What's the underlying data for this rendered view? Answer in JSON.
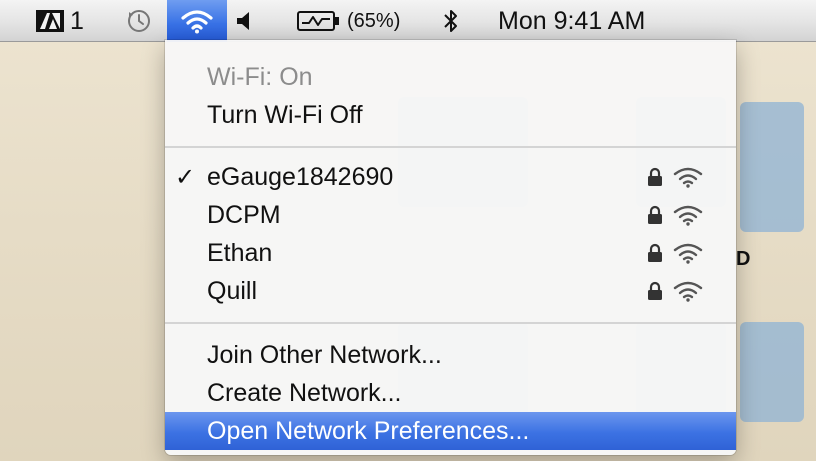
{
  "menubar": {
    "adobe": {
      "icon": "adobe-creative-cloud-icon",
      "count": "1"
    },
    "time_machine_icon": "time-machine-clock-icon",
    "wifi_icon": "wifi-icon",
    "volume_icon": "speaker-icon",
    "battery": {
      "icon": "battery-charging-icon",
      "percent": "(65%)"
    },
    "bluetooth_icon": "bluetooth-icon",
    "clock": "Mon 9:41 AM",
    "accent_color": "#3a73e6"
  },
  "wifi_menu": {
    "status": "Wi-Fi: On",
    "toggle_label": "Turn Wi-Fi Off",
    "networks": [
      {
        "name": "eGauge1842690",
        "checked": true,
        "locked": true,
        "signal": "full"
      },
      {
        "name": "DCPM",
        "checked": false,
        "locked": true,
        "signal": "full"
      },
      {
        "name": "Ethan",
        "checked": false,
        "locked": true,
        "signal": "full"
      },
      {
        "name": "Quill",
        "checked": false,
        "locked": true,
        "signal": "full"
      }
    ],
    "checkmark": "✓",
    "join_other": "Join Other Network...",
    "create_network": "Create Network...",
    "open_prefs": "Open Network Preferences...",
    "highlight_color": "#3c72e3"
  },
  "desktop": {
    "partial_label": "D"
  }
}
